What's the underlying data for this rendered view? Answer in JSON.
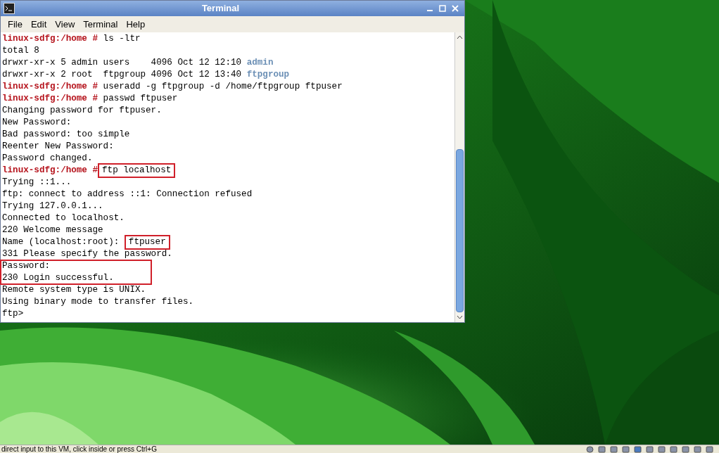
{
  "window": {
    "title": "Terminal"
  },
  "menu": [
    {
      "label": "File"
    },
    {
      "label": "Edit"
    },
    {
      "label": "View"
    },
    {
      "label": "Terminal"
    },
    {
      "label": "Help"
    }
  ],
  "terminal": {
    "lines": [
      {
        "highlighted": false,
        "segments": [
          {
            "kind": "prompt",
            "text": "linux-sdfg:/home #"
          },
          {
            "kind": "text",
            "text": " ls -ltr",
            "highlighted": false
          }
        ]
      },
      {
        "highlighted": false,
        "segments": [
          {
            "kind": "text",
            "text": "total 8",
            "highlighted": false
          }
        ]
      },
      {
        "highlighted": false,
        "segments": [
          {
            "kind": "text",
            "text": "drwxr-xr-x 5 admin users    4096 Oct 12 12:10 ",
            "highlighted": false
          },
          {
            "kind": "dir",
            "text": "admin"
          }
        ]
      },
      {
        "highlighted": false,
        "segments": [
          {
            "kind": "text",
            "text": "drwxr-xr-x 2 root  ftpgroup 4096 Oct 12 13:40 ",
            "highlighted": false
          },
          {
            "kind": "dir",
            "text": "ftpgroup"
          }
        ]
      },
      {
        "highlighted": false,
        "segments": [
          {
            "kind": "prompt",
            "text": "linux-sdfg:/home #"
          },
          {
            "kind": "text",
            "text": " useradd -g ftpgroup -d /home/ftpgroup ftpuser",
            "highlighted": false
          }
        ]
      },
      {
        "highlighted": false,
        "segments": [
          {
            "kind": "prompt",
            "text": "linux-sdfg:/home #"
          },
          {
            "kind": "text",
            "text": " passwd ftpuser",
            "highlighted": false
          }
        ]
      },
      {
        "highlighted": false,
        "segments": [
          {
            "kind": "text",
            "text": "Changing password for ftpuser.",
            "highlighted": false
          }
        ]
      },
      {
        "highlighted": false,
        "segments": [
          {
            "kind": "text",
            "text": "New Password:",
            "highlighted": false
          }
        ]
      },
      {
        "highlighted": false,
        "segments": [
          {
            "kind": "text",
            "text": "Bad password: too simple",
            "highlighted": false
          }
        ]
      },
      {
        "highlighted": false,
        "segments": [
          {
            "kind": "text",
            "text": "Reenter New Password:",
            "highlighted": false
          }
        ]
      },
      {
        "highlighted": false,
        "segments": [
          {
            "kind": "text",
            "text": "Password changed.",
            "highlighted": false
          }
        ]
      },
      {
        "highlighted": false,
        "segments": [
          {
            "kind": "prompt",
            "text": "linux-sdfg:/home #"
          },
          {
            "kind": "text",
            "text": "ftp localhost",
            "highlighted": true
          }
        ]
      },
      {
        "highlighted": false,
        "segments": [
          {
            "kind": "text",
            "text": "Trying ::1...",
            "highlighted": false
          }
        ]
      },
      {
        "highlighted": false,
        "segments": [
          {
            "kind": "text",
            "text": "ftp: connect to address ::1: Connection refused",
            "highlighted": false
          }
        ]
      },
      {
        "highlighted": false,
        "segments": [
          {
            "kind": "text",
            "text": "Trying 127.0.0.1...",
            "highlighted": false
          }
        ]
      },
      {
        "highlighted": false,
        "segments": [
          {
            "kind": "text",
            "text": "Connected to localhost.",
            "highlighted": false
          }
        ]
      },
      {
        "highlighted": false,
        "segments": [
          {
            "kind": "text",
            "text": "220 Welcome message",
            "highlighted": false
          }
        ]
      },
      {
        "highlighted": false,
        "segments": [
          {
            "kind": "text",
            "text": "Name (localhost:root): ",
            "highlighted": false
          },
          {
            "kind": "text",
            "text": "ftpuser",
            "highlighted": true
          }
        ]
      },
      {
        "highlighted": false,
        "segments": [
          {
            "kind": "text",
            "text": "331 Please specify the password.",
            "highlighted": false
          }
        ]
      },
      {
        "highlighted": true,
        "segments": [
          {
            "kind": "text",
            "text": "Password:",
            "highlighted": false
          }
        ]
      },
      {
        "highlighted": true,
        "segments": [
          {
            "kind": "text",
            "text": "230 Login successful.",
            "highlighted": false
          }
        ]
      },
      {
        "highlighted": false,
        "segments": [
          {
            "kind": "text",
            "text": "Remote system type is UNIX.",
            "highlighted": false
          }
        ]
      },
      {
        "highlighted": false,
        "segments": [
          {
            "kind": "text",
            "text": "Using binary mode to transfer files.",
            "highlighted": false
          }
        ]
      },
      {
        "highlighted": false,
        "segments": [
          {
            "kind": "text",
            "text": "ftp>",
            "highlighted": false
          }
        ]
      }
    ]
  },
  "status_bar": {
    "text": "direct input to this VM, click inside or press Ctrl+G"
  }
}
